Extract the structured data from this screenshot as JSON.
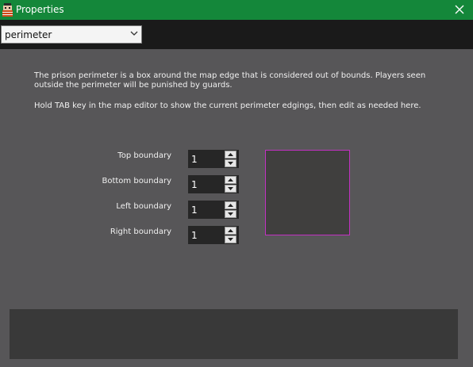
{
  "window": {
    "title": "Properties",
    "app_icon": "prisoner-icon",
    "close_icon": "close-icon"
  },
  "toolbar": {
    "dropdown": {
      "selected": "perimeter",
      "icon": "chevron-down-icon"
    }
  },
  "content": {
    "description_1": "The prison perimeter is a box around the map edge that is considered out of bounds. Players seen outside the perimeter will be punished by guards.",
    "description_2": "Hold TAB key in the map editor to show the current perimeter edgings, then edit as needed here.",
    "fields": [
      {
        "label": "Top boundary",
        "value": "1"
      },
      {
        "label": "Bottom boundary",
        "value": "1"
      },
      {
        "label": "Left boundary",
        "value": "1"
      },
      {
        "label": "Right boundary",
        "value": "1"
      }
    ],
    "spinner_icons": {
      "up": "arrow-up-icon",
      "down": "arrow-down-icon"
    }
  },
  "colors": {
    "titlebar": "#14873a",
    "background": "#575658",
    "toolbar": "#1a1a1a",
    "preview_border": "#c230c2",
    "preview_fill": "#403f3e",
    "footer_panel": "#393939"
  }
}
